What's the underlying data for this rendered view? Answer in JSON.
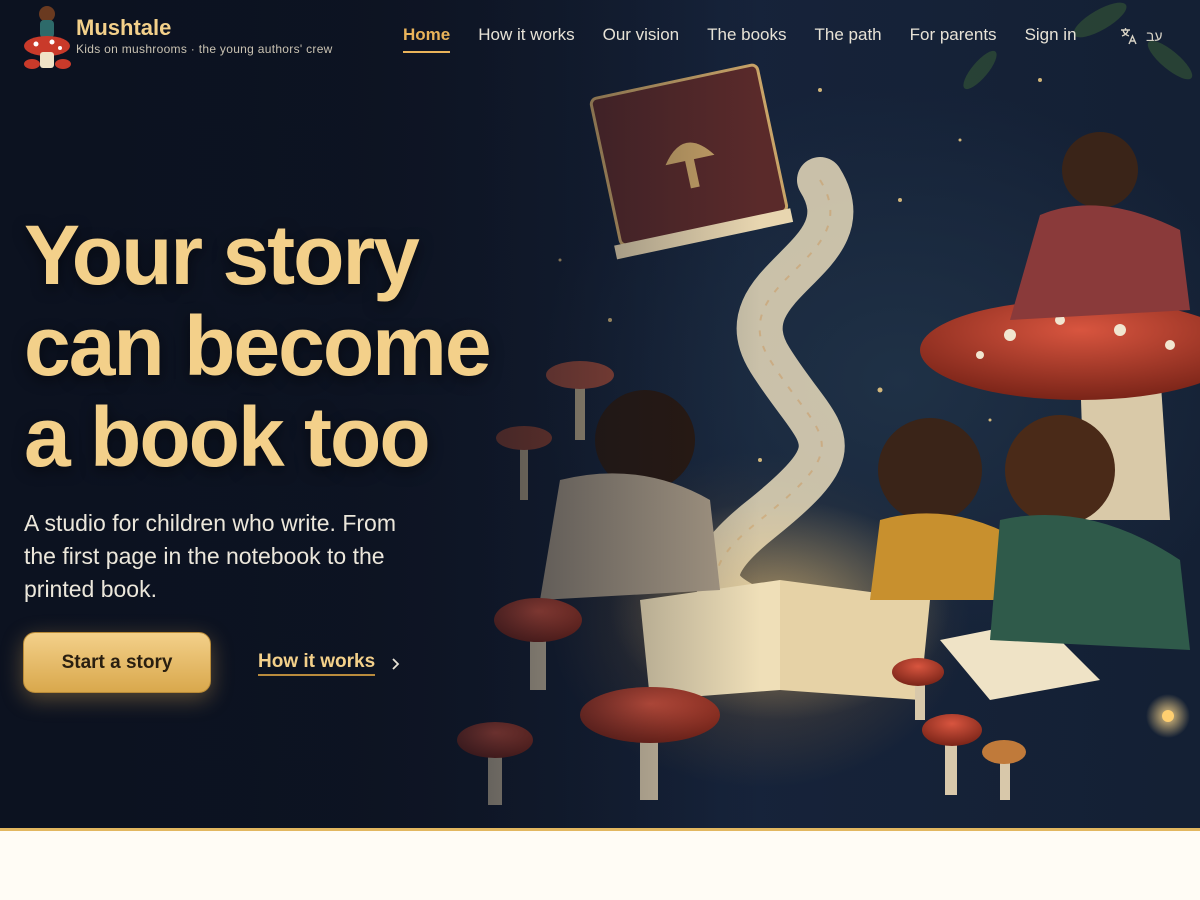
{
  "brand": {
    "name": "Mushtale",
    "tagline": "Kids on mushrooms · the young authors' crew"
  },
  "nav": {
    "items": [
      {
        "label": "Home",
        "active": true
      },
      {
        "label": "How it works"
      },
      {
        "label": "Our vision"
      },
      {
        "label": "The books"
      },
      {
        "label": "The path"
      },
      {
        "label": "For parents"
      },
      {
        "label": "Sign in"
      }
    ]
  },
  "language": {
    "icon": "translate-icon",
    "label": "עב"
  },
  "hero": {
    "headline": [
      "Your story",
      "can become",
      "a book too"
    ],
    "subtitle": "A studio for children who write. From the first page in the notebook to the printed book.",
    "primary_cta": "Start a story",
    "secondary_cta": "How it works",
    "secondary_icon": "chevron-right-icon"
  },
  "colors": {
    "accent": "#e9b35a",
    "headline": "#f3d08a",
    "background": "#0d1424",
    "below": "#fffcf5"
  }
}
